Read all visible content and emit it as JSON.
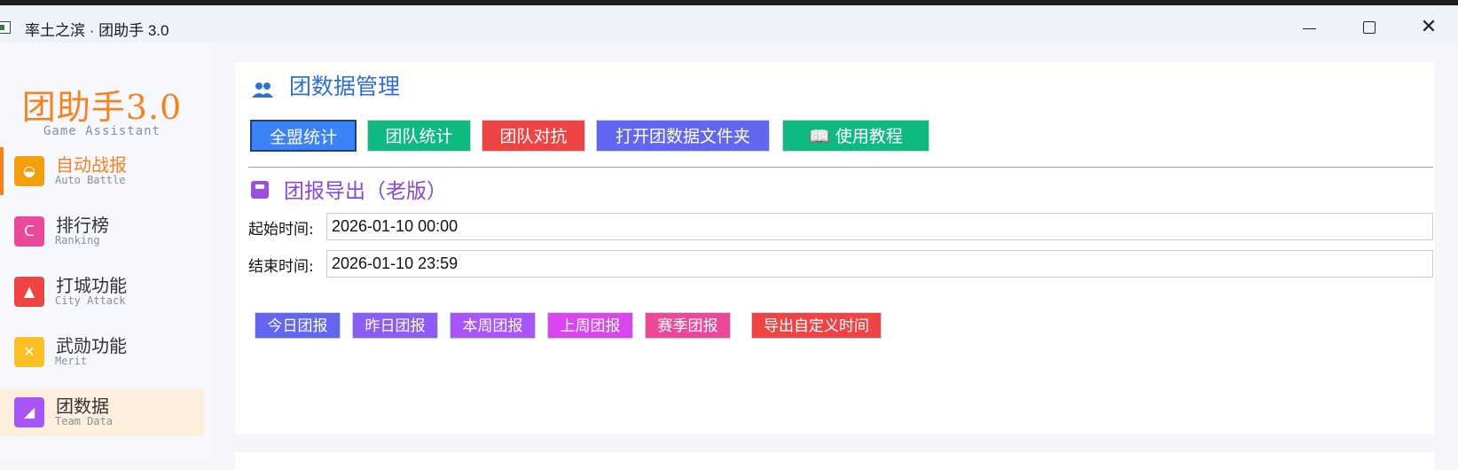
{
  "window": {
    "title": "率土之滨 · 团助手 3.0",
    "minimize": "—",
    "maximize": "☐",
    "close": "✕"
  },
  "sidebar": {
    "brand": "团助手3.0",
    "brand_sub": "Game Assistant",
    "items": [
      {
        "label": "自动战报",
        "en": "Auto Battle",
        "icon": "gauge-icon",
        "color": "#f59e0b"
      },
      {
        "label": "排行榜",
        "en": "Ranking",
        "icon": "trophy-icon",
        "color": "#ec4899"
      },
      {
        "label": "打城功能",
        "en": "City Attack",
        "icon": "castle-icon",
        "color": "#ef4444"
      },
      {
        "label": "武勋功能",
        "en": "Merit",
        "icon": "swords-icon",
        "color": "#fbbf24"
      },
      {
        "label": "团数据",
        "en": "Team Data",
        "icon": "chart-icon",
        "color": "#a855f7"
      }
    ]
  },
  "main": {
    "title": "团数据管理",
    "buttons": [
      {
        "label": "全盟统计",
        "color": "#3b82f6"
      },
      {
        "label": "团队统计",
        "color": "#10b981"
      },
      {
        "label": "团队对抗",
        "color": "#ef4444"
      },
      {
        "label": "打开团数据文件夹",
        "color": "#6366f1"
      },
      {
        "label": "📖 使用教程",
        "color": "#10b981"
      }
    ],
    "export_title": "团报导出（老版）",
    "start_label": "起始时间:",
    "start_value": "2026-01-10 00:00",
    "end_label": "结束时间:",
    "end_value": "2026-01-10 23:59",
    "quick": [
      {
        "label": "今日团报",
        "color": "#6366f1"
      },
      {
        "label": "昨日团报",
        "color": "#8b5cf6"
      },
      {
        "label": "本周团报",
        "color": "#a855f7"
      },
      {
        "label": "上周团报",
        "color": "#d946ef"
      },
      {
        "label": "赛季团报",
        "color": "#ec4899"
      },
      {
        "label": "导出自定义时间",
        "color": "#ef4444"
      }
    ]
  }
}
